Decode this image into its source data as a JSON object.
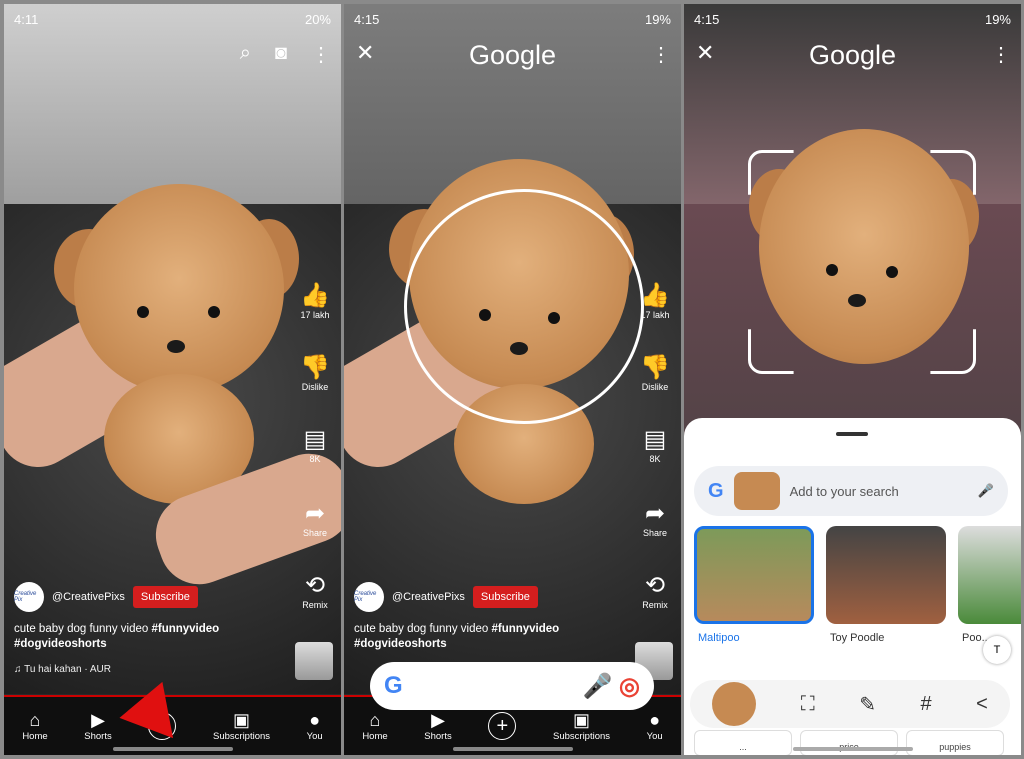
{
  "panels": [
    {
      "status": {
        "time": "4:11",
        "battery": "20%"
      }
    },
    {
      "status": {
        "time": "4:15",
        "battery": "19%"
      }
    },
    {
      "status": {
        "time": "4:15",
        "battery": "19%"
      }
    }
  ],
  "rail": {
    "likes": "17 lakh",
    "dislike": "Dislike",
    "comments": "8K",
    "share": "Share",
    "remix": "Remix"
  },
  "video": {
    "channel": "@CreativePixs",
    "channel_avatar": "Creative Pix",
    "subscribe": "Subscribe",
    "caption": "cute baby dog funny video ",
    "tag1": "#funnyvideo",
    "tag2": "#dogvideoshorts",
    "music": "Tu hai kahan · AUR"
  },
  "nav": {
    "home": "Home",
    "shorts": "Shorts",
    "subscriptions": "Subscriptions",
    "you": "You"
  },
  "lens": {
    "title": "Google",
    "search_placeholder": "Add to your search",
    "results": [
      {
        "label": "Maltipoo"
      },
      {
        "label": "Toy Poodle"
      },
      {
        "label": "Poo..."
      }
    ],
    "chips": [
      "...",
      "price",
      "puppies"
    ]
  },
  "colors": {
    "subscribe": "#d51e1e",
    "accent": "#1a73e8"
  }
}
